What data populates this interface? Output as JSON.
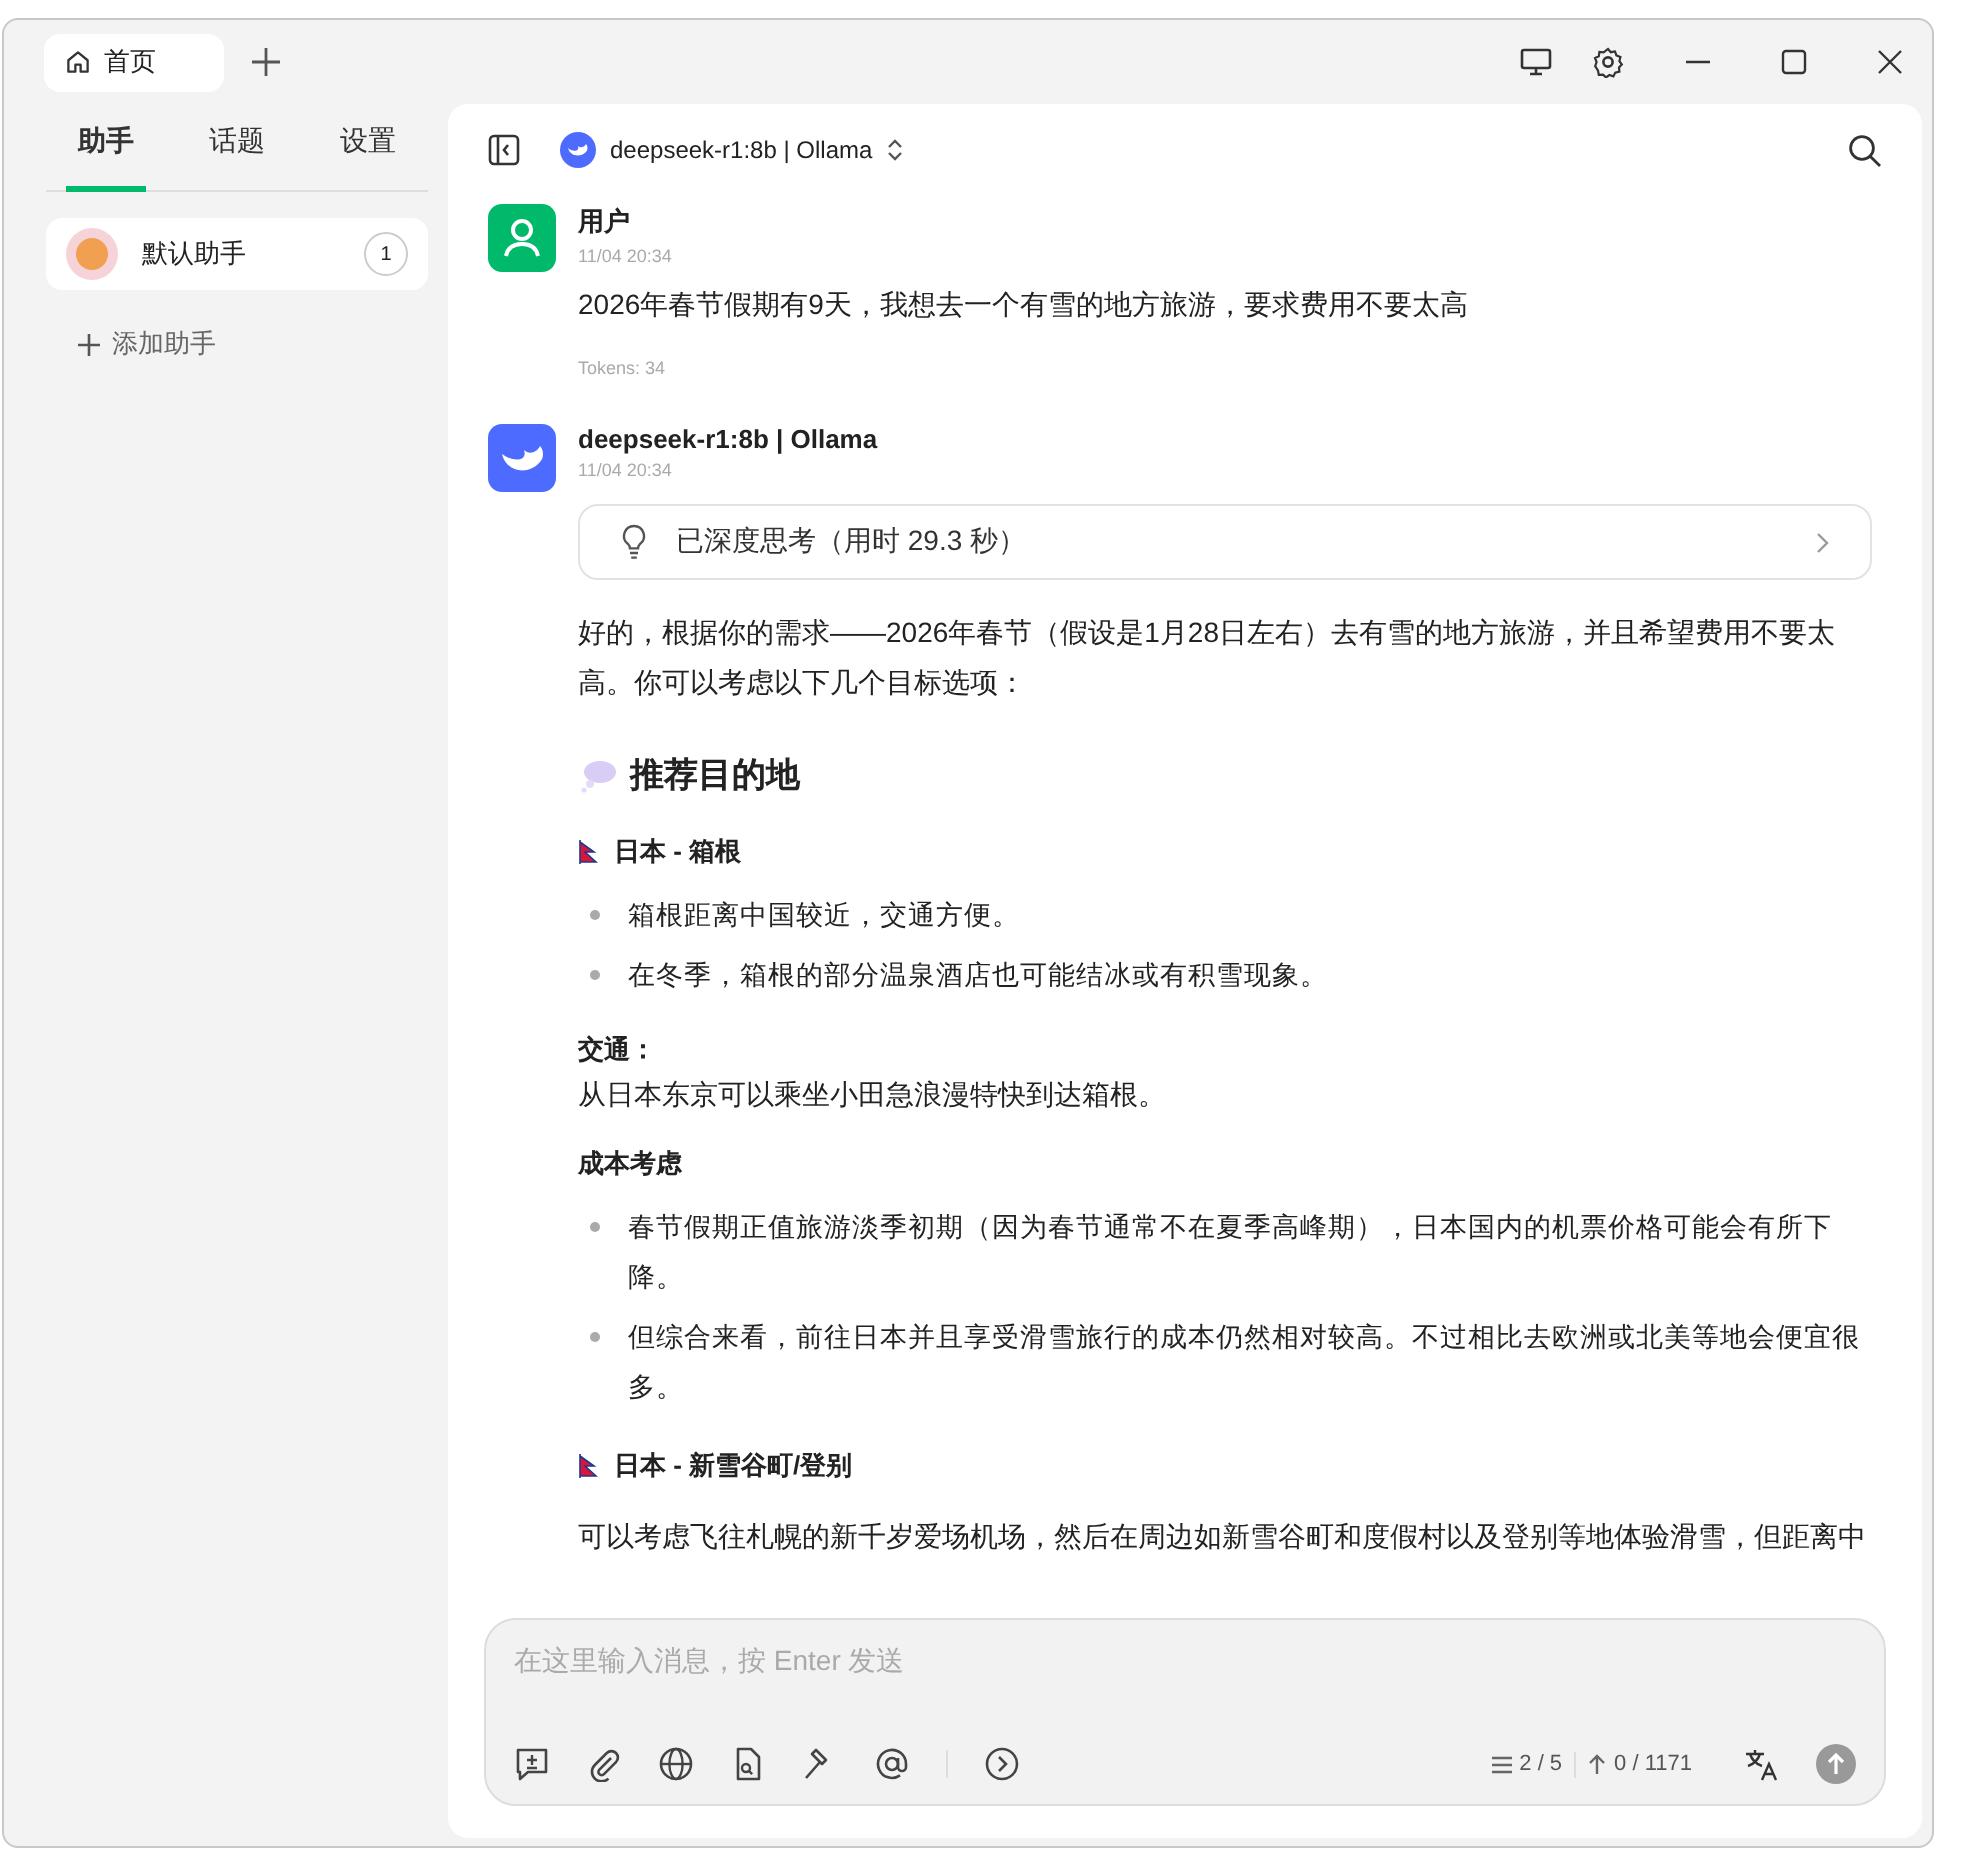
{
  "tabs": [
    {
      "label": "首页",
      "selected": true
    }
  ],
  "sidebar": {
    "tabs": [
      {
        "label": "助手",
        "selected": true
      },
      {
        "label": "话题",
        "selected": false
      },
      {
        "label": "设置",
        "selected": false
      }
    ],
    "assistants": [
      {
        "name": "默认助手",
        "count": "1",
        "selected": true
      }
    ],
    "add_label": "添加助手"
  },
  "header": {
    "model": "deepseek-r1:8b | Ollama"
  },
  "messages": [
    {
      "kind": "user",
      "author": "用户",
      "time": "11/04 20:34",
      "text": "2026年春节假期有9天，我想去一个有雪的地方旅游，要求费用不要太高",
      "tokens": "Tokens: 34"
    },
    {
      "kind": "assistant",
      "author": "deepseek-r1:8b | Ollama",
      "time": "11/04 20:34",
      "thinking": "已深度思考（用时 29.3 秒）",
      "blocks": [
        {
          "kind": "para",
          "text": "好的，根据你的需求——2026年春节（假设是1月28日左右）去有雪的地方旅游，并且希望费用不要太高。你可以考虑以下几个目标选项："
        },
        {
          "kind": "h2",
          "text": "推荐目的地"
        },
        {
          "kind": "h3",
          "text": "日本 - 箱根"
        },
        {
          "kind": "list",
          "items": [
            "箱根距离中国较近，交通方便。",
            "在冬季，箱根的部分温泉酒店也可能结冰或有积雪现象。"
          ]
        },
        {
          "kind": "label",
          "text": "交通："
        },
        {
          "kind": "line",
          "text": "从日本东京可以乘坐小田急浪漫特快到达箱根。"
        },
        {
          "kind": "label",
          "text": "成本考虑"
        },
        {
          "kind": "list",
          "items": [
            "春节假期正值旅游淡季初期（因为春节通常不在夏季高峰期），日本国内的机票价格可能会有所下降。",
            "但综合来看，前往日本并且享受滑雪旅行的成本仍然相对较高。不过相比去欧洲或北美等地会便宜很多。"
          ]
        },
        {
          "kind": "h3",
          "text": "日本 - 新雪谷町/登别"
        },
        {
          "kind": "para",
          "text": "可以考虑飞往札幌的新千岁爱场机场，然后在周边如新雪谷町和度假村以及登别等地体验滑雪，但距离中"
        }
      ]
    }
  ],
  "composer": {
    "placeholder": "在这里输入消息，按 Enter 发送",
    "context": "2 / 5",
    "tokens": "0 / 1171"
  }
}
